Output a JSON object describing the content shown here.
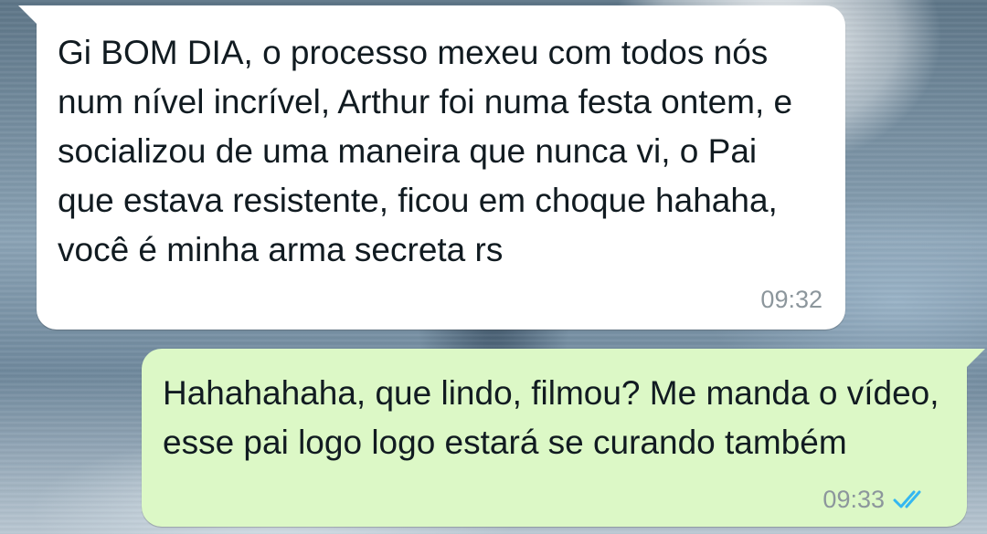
{
  "messages": [
    {
      "direction": "incoming",
      "text": "Gi BOM DIA, o processo mexeu com todos nós num nível incrível, Arthur foi numa festa ontem, e socializou de uma maneira que nunca vi, o Pai que estava resistente, ficou em choque hahaha, você é minha arma secreta rs",
      "time": "09:32"
    },
    {
      "direction": "outgoing",
      "text": "Hahahahaha, que lindo, filmou? Me manda o vídeo, esse pai logo logo estará se curando também",
      "time": "09:33",
      "status_icon": "double-check-read-icon"
    }
  ],
  "colors": {
    "incoming_bubble": "#ffffff",
    "outgoing_bubble": "#dcf8c6",
    "read_ticks": "#34b7f1",
    "timestamp": "#8c969c"
  }
}
